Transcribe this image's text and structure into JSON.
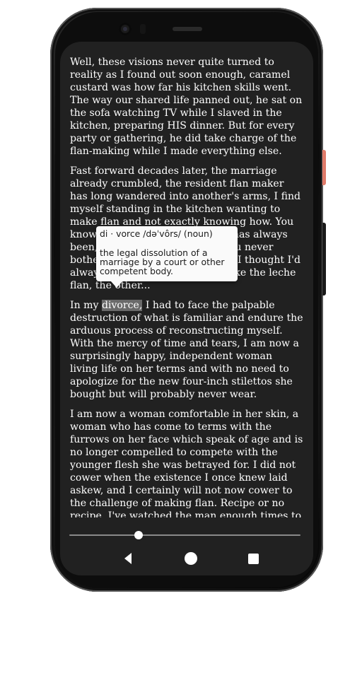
{
  "reader": {
    "paragraphs": [
      "Well, these visions never quite turned to reality as I found out soon enough, caramel custard was how far his kitchen skills went. The way our shared life panned out, he sat on the sofa watching TV while I slaved in the kitchen, preparing HIS dinner. But for every party or gathering, he did take charge of the flan-making while I made everything else.",
      "Fast forward decades later, the marriage already crumbled, the resident flan maker has long wandered into another's arms, I find myself standing in the kitchen wanting to make flan and not exactly knowing how. You know how it is when something has always been, you assume it's forever. You never bother to learn a recipe because I thought I'd always be there whenever to make the leche flan, the other...",
      "I am now a woman comfortable in her skin, a woman who has come to terms with the furrows on her face which speak of age and is no longer compelled to compete with the younger flesh she was betrayed for. I did not cower when the existence I once knew laid askew, and I certainly will not now cower to the challenge of making flan. Recipe or no recipe, I've watched the man enough times to learn his techniques, and I can surely figure out the measurements of eggs and sugar."
    ],
    "p3_before": "In my ",
    "highlighted_word": "divorce,",
    "p3_after": " I had to face the palpable destruction of what is familiar and endure the arduous process of reconstructing myself. With the mercy of time and tears, I am now a surprisingly happy, independent woman living life on her terms and with no need to apologize for the new four-inch stilettos she bought but will probably never wear."
  },
  "dictionary_popup": {
    "pronunciation": "di · vorce /dəˈvôrs/ (noun)",
    "definition": "the legal dissolution of a marriage by a court or other competent body."
  },
  "progress": {
    "fraction": 0.3
  },
  "nav_bar": {
    "icons": [
      "back-icon",
      "home-icon",
      "recents-icon"
    ]
  },
  "colors": {
    "screen_background": "#212121",
    "text": "#ffffff",
    "highlight": "#6a6a6a",
    "popup_background": "#fafafa",
    "side_button_accent": "#e07b6a"
  }
}
